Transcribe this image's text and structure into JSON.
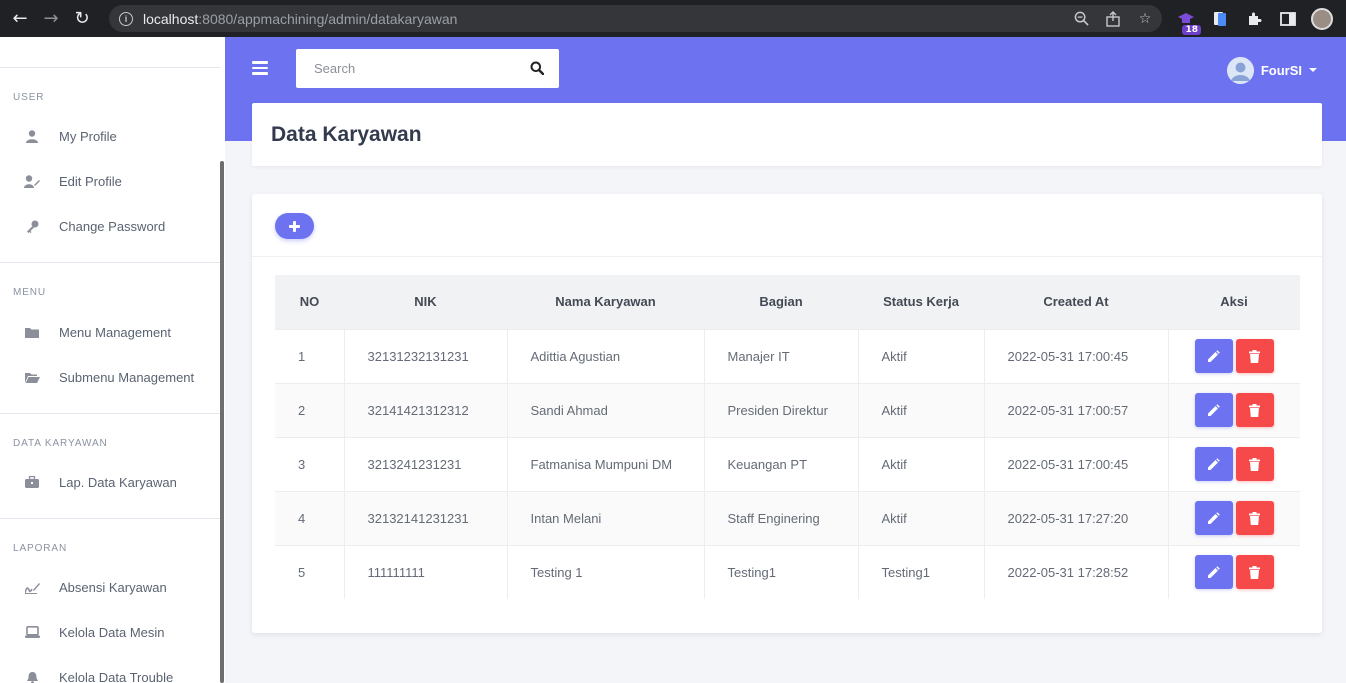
{
  "browser": {
    "url_host": "localhost",
    "url_rest": ":8080/appmachining/admin/datakaryawan",
    "extension_badge": "18"
  },
  "sidebar": {
    "sections": [
      {
        "heading": "USER",
        "items": [
          {
            "label": "My Profile",
            "icon": "user-icon"
          },
          {
            "label": "Edit Profile",
            "icon": "user-edit-icon"
          },
          {
            "label": "Change Password",
            "icon": "key-icon"
          }
        ]
      },
      {
        "heading": "MENU",
        "items": [
          {
            "label": "Menu Management",
            "icon": "folder-icon"
          },
          {
            "label": "Submenu Management",
            "icon": "folder-open-icon"
          }
        ]
      },
      {
        "heading": "DATA KARYAWAN",
        "items": [
          {
            "label": "Lap. Data Karyawan",
            "icon": "briefcase-icon"
          }
        ]
      },
      {
        "heading": "LAPORAN",
        "items": [
          {
            "label": "Absensi Karyawan",
            "icon": "signature-icon"
          },
          {
            "label": "Kelola Data Mesin",
            "icon": "laptop-icon"
          },
          {
            "label": "Kelola Data Trouble",
            "icon": "bell-icon"
          }
        ]
      }
    ]
  },
  "topnav": {
    "search_placeholder": "Search",
    "user_name": "FourSI"
  },
  "page": {
    "title": "Data Karyawan"
  },
  "table": {
    "headers": [
      "NO",
      "NIK",
      "Nama Karyawan",
      "Bagian",
      "Status Kerja",
      "Created At",
      "Aksi"
    ],
    "rows": [
      {
        "no": "1",
        "nik": "32131232131231",
        "nama": "Adittia Agustian",
        "bagian": "Manajer IT",
        "status": "Aktif",
        "created": "2022-05-31 17:00:45"
      },
      {
        "no": "2",
        "nik": "32141421312312",
        "nama": "Sandi Ahmad",
        "bagian": "Presiden Direktur",
        "status": "Aktif",
        "created": "2022-05-31 17:00:57"
      },
      {
        "no": "3",
        "nik": "3213241231231",
        "nama": "Fatmanisa Mumpuni DM",
        "bagian": "Keuangan PT",
        "status": "Aktif",
        "created": "2022-05-31 17:00:45"
      },
      {
        "no": "4",
        "nik": "32132141231231",
        "nama": "Intan Melani",
        "bagian": "Staff Enginering",
        "status": "Aktif",
        "created": "2022-05-31 17:27:20"
      },
      {
        "no": "5",
        "nik": "111111111",
        "nama": "Testing 1",
        "bagian": "Testing1",
        "status": "Testing1",
        "created": "2022-05-31 17:28:52"
      }
    ]
  },
  "colors": {
    "primary": "#6c72f0",
    "danger": "#f5494a",
    "background": "#f4f5f9"
  }
}
